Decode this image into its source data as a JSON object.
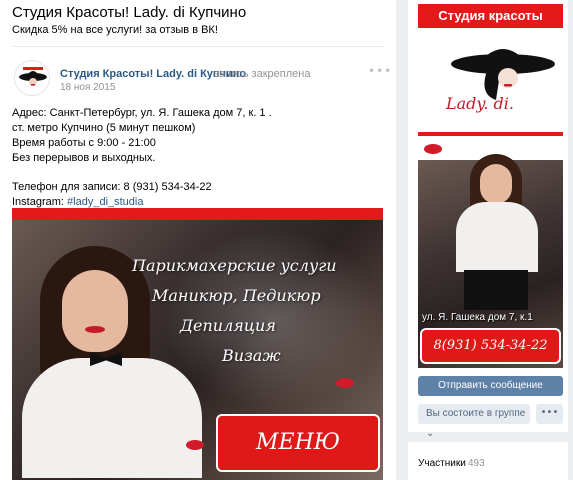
{
  "group": {
    "title": "Студия Красоты! Lady. di Купчино",
    "status": "Скидка 5% на все услуги! за отзыв в ВК!"
  },
  "post": {
    "author": "Студия Красоты! Lady. di Купчино",
    "pinned_label": "запись закреплена",
    "date": "18 ноя 2015",
    "more_label": "•••",
    "lines": [
      "Адрес: Санкт-Петербург, ул. Я. Гашека дом 7, к. 1 .",
      "ст. метро Купчино (5 минут пешком)",
      "Время работы с 9:00 - 21:00",
      "Без перерывов и выходных."
    ],
    "phone_line": "Телефон для записи: 8 (931) 534-34-22",
    "instagram_label": "Instagram: ",
    "hashtag": "#lady_di_studia",
    "image": {
      "promo_lines": [
        "Парикмахерские услуги",
        "Маникюр, Педикюр",
        "Депиляция",
        "Визаж"
      ],
      "menu_label": "МЕНЮ"
    }
  },
  "sidebar": {
    "banner": {
      "header": "Студия красоты",
      "brand": "Lady. di.",
      "address": "ул. Я. Гашека дом 7, к.1",
      "phone": "8(931) 534-34-22"
    },
    "send_message_label": "Отправить сообщение",
    "member_label": "Вы состоите в группе ⌄",
    "more_label": "•••",
    "members_label": "Участники",
    "members_count": "493"
  },
  "colors": {
    "accent_red": "#e41a1a",
    "link_blue": "#2a5885",
    "button_blue": "#5e81a8"
  }
}
